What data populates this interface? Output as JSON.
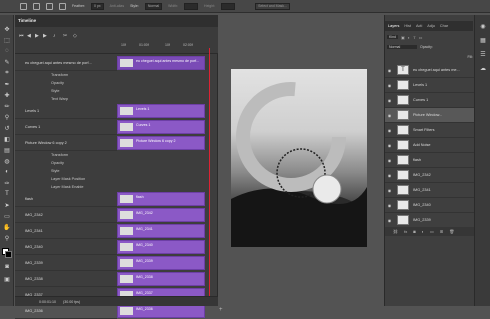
{
  "options_bar": {
    "feather_label": "Feather:",
    "feather_value": "0 px",
    "antialias_label": "Anti-alias",
    "style_label": "Style:",
    "style_value": "Normal",
    "width_label": "Width:",
    "height_label": "Height:",
    "select_mask_label": "Select and Mask..."
  },
  "timeline": {
    "title": "Timeline",
    "ruler_ticks": [
      "10f",
      "01:00f",
      "10f",
      "02:00f"
    ],
    "time_display": "0:00:01:10",
    "fps": "(30.00 fps)",
    "rows": [
      {
        "name": "eu cheguei aqui antes mesmo de porf...",
        "type": "layer",
        "clip": "eu cheguei aqui antes mesmo de porf..."
      },
      {
        "name": "Transform",
        "type": "prop"
      },
      {
        "name": "Opacity",
        "type": "prop"
      },
      {
        "name": "Style",
        "type": "prop"
      },
      {
        "name": "Text Warp",
        "type": "prop"
      },
      {
        "name": "Levels 1",
        "type": "layer",
        "clip": "Levels 1"
      },
      {
        "name": "Curves 1",
        "type": "layer",
        "clip": "Curves 1"
      },
      {
        "name": "Picture Window 6 copy 2",
        "type": "layer",
        "clip": "Picture Window 6 copy 2"
      },
      {
        "name": "Transform",
        "type": "prop"
      },
      {
        "name": "Opacity",
        "type": "prop"
      },
      {
        "name": "Style",
        "type": "prop"
      },
      {
        "name": "Layer Mask Position",
        "type": "prop"
      },
      {
        "name": "Layer Mask Enable",
        "type": "prop"
      },
      {
        "name": "flash",
        "type": "layer",
        "clip": "flash"
      },
      {
        "name": "IMG_2342",
        "type": "layer",
        "clip": "IMG_2342"
      },
      {
        "name": "IMG_2341",
        "type": "layer",
        "clip": "IMG_2341"
      },
      {
        "name": "IMG_2340",
        "type": "layer",
        "clip": "IMG_2340"
      },
      {
        "name": "IMG_2339",
        "type": "layer",
        "clip": "IMG_2339"
      },
      {
        "name": "IMG_2338",
        "type": "layer",
        "clip": "IMG_2338"
      },
      {
        "name": "IMG_2337",
        "type": "layer",
        "clip": "IMG_2337"
      },
      {
        "name": "IMG_2336",
        "type": "layer",
        "clip": "IMG_2336"
      }
    ]
  },
  "layers_panel": {
    "tabs": [
      "Layers",
      "Hist",
      "Acti",
      "Adju",
      "Char"
    ],
    "filter_label": "Kind",
    "blend_mode": "Normal",
    "opacity_label": "Opacity:",
    "fill_label": "Fill:",
    "items": [
      {
        "name": "eu cheguei aqui antes me...",
        "thumb": "T"
      },
      {
        "name": "Levels 1",
        "thumb": ""
      },
      {
        "name": "Curves 1",
        "thumb": ""
      },
      {
        "name": "Picture Window...",
        "thumb": ""
      },
      {
        "name": "Smart Filters",
        "thumb": ""
      },
      {
        "name": "Add Noise",
        "thumb": ""
      },
      {
        "name": "flash",
        "thumb": ""
      },
      {
        "name": "IMG_2342",
        "thumb": ""
      },
      {
        "name": "IMG_2341",
        "thumb": ""
      },
      {
        "name": "IMG_2340",
        "thumb": ""
      },
      {
        "name": "IMG_2339",
        "thumb": ""
      }
    ]
  },
  "colors": {
    "clip": "#8b59c6",
    "playhead": "#dd2233",
    "panel": "#3f3f3f"
  }
}
